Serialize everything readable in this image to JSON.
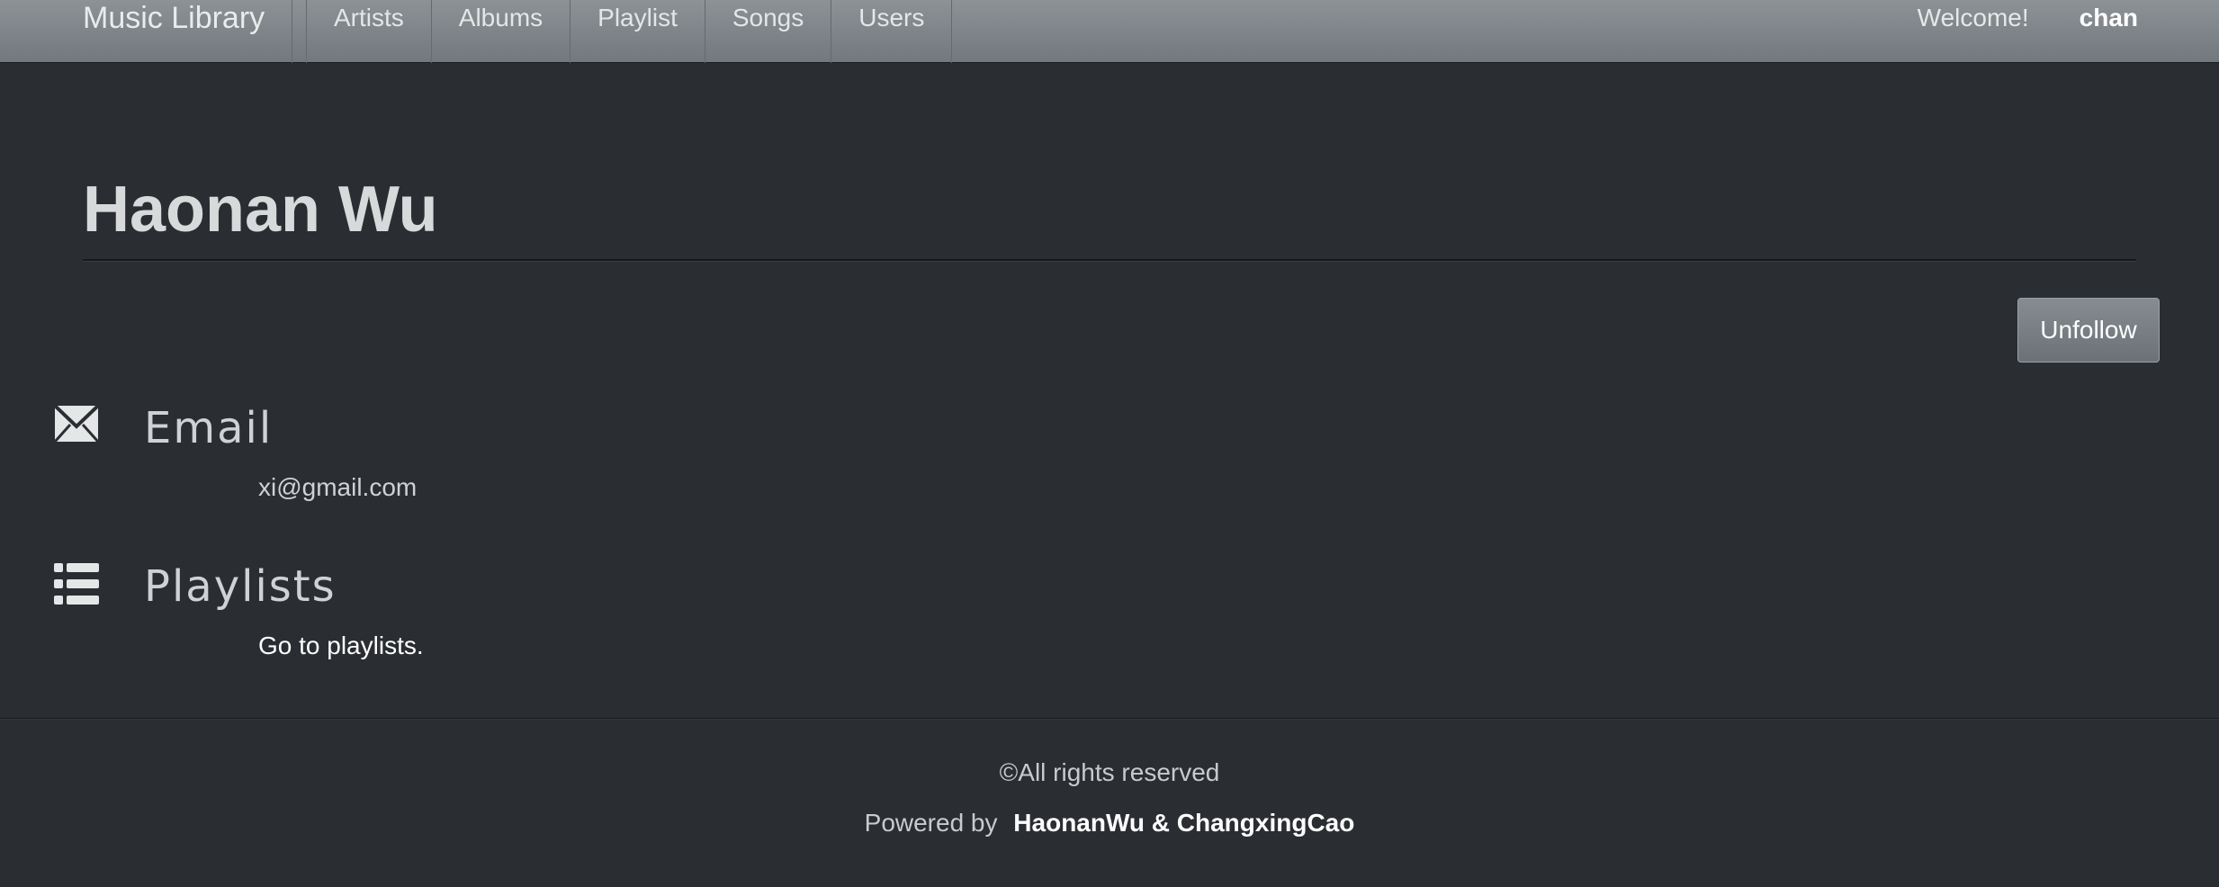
{
  "navbar": {
    "brand": "Music Library",
    "items": [
      {
        "label": "Artists"
      },
      {
        "label": "Albums"
      },
      {
        "label": "Playlist"
      },
      {
        "label": "Songs"
      },
      {
        "label": "Users"
      }
    ],
    "welcome": "Welcome!",
    "username": "chan"
  },
  "profile": {
    "name": "Haonan Wu",
    "unfollow_label": "Unfollow"
  },
  "sections": {
    "email": {
      "icon": "envelope-icon",
      "heading": "Email",
      "value": "xi@gmail.com"
    },
    "playlists": {
      "icon": "list-icon",
      "heading": "Playlists",
      "link": "Go to playlists."
    }
  },
  "footer": {
    "copyright": "©All rights reserved",
    "powered_prefix": "Powered by",
    "authors": "HaonanWu & ChangxingCao"
  }
}
